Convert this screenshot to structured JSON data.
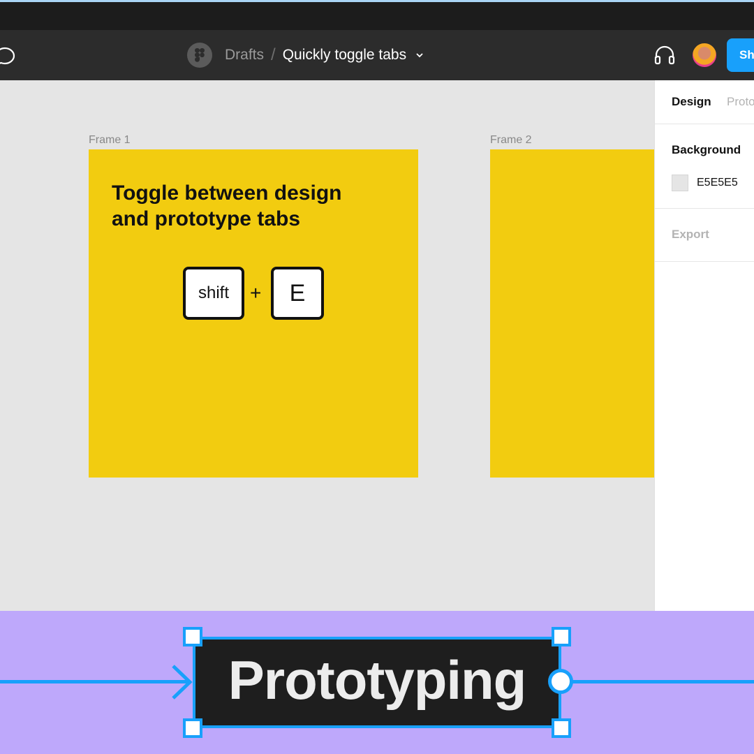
{
  "toolbar": {
    "breadcrumb_folder": "Drafts",
    "breadcrumb_separator": "/",
    "file_name": "Quickly toggle tabs",
    "share_label": "Sh"
  },
  "canvas": {
    "frames": [
      {
        "label": "Frame 1",
        "heading_line1": "Toggle between design",
        "heading_line2": "and prototype tabs",
        "shortcut": {
          "key1": "shift",
          "plus": "+",
          "key2": "E"
        }
      },
      {
        "label": "Frame 2"
      }
    ],
    "frame_color": "#F2CC10"
  },
  "panel": {
    "tabs": [
      "Design",
      "Proto"
    ],
    "background_title": "Background",
    "background_hex": "E5E5E5",
    "export_title": "Export"
  },
  "banner": {
    "label": "Prototyping",
    "accent": "#18A0FB",
    "background": "#BEA8FB"
  },
  "icons": [
    "comment-icon",
    "figma-logo-icon",
    "chevron-down-icon",
    "headset-icon"
  ]
}
